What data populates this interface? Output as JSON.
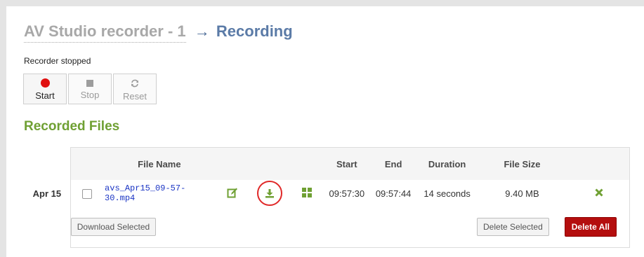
{
  "breadcrumb": {
    "parent": "AV Studio recorder - 1",
    "arrow": "→",
    "current": "Recording"
  },
  "status_text": "Recorder stopped",
  "controls": {
    "start_label": "Start",
    "stop_label": "Stop",
    "reset_label": "Reset",
    "start_icon_color": "#e01010"
  },
  "recorded_files": {
    "title": "Recorded Files",
    "columns": {
      "file_name": "File Name",
      "start": "Start",
      "end": "End",
      "duration": "Duration",
      "file_size": "File Size"
    },
    "rows": [
      {
        "date": "Apr 15",
        "file_name": "avs_Apr15_09-57-30.mp4",
        "start": "09:57:30",
        "end": "09:57:44",
        "duration": "14 seconds",
        "file_size": "9.40 MB",
        "icons": [
          "edit-icon",
          "download-icon",
          "grid-icon",
          "delete-icon"
        ]
      }
    ],
    "download_selected_label": "Download Selected",
    "delete_selected_label": "Delete Selected",
    "delete_all_label": "Delete All"
  },
  "colors": {
    "accent_green": "#6fa033",
    "title_blue": "#5b7ba7",
    "danger_red": "#b40e0e",
    "highlight_circle": "#e02828"
  }
}
